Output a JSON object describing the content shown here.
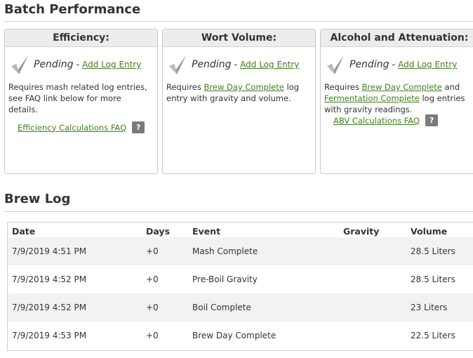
{
  "batch_performance": {
    "title": "Batch Performance",
    "cards": [
      {
        "header": "Efficiency:",
        "status": "Pending",
        "dash": "-",
        "action_label": "Add Log Entry",
        "desc_text": "Requires mash related log entries, see FAQ link below for more details.",
        "faq_label": "Efficiency Calculations FAQ",
        "help_glyph": "?"
      },
      {
        "header": "Wort Volume:",
        "status": "Pending",
        "dash": "-",
        "action_label": "Add Log Entry",
        "desc_prefix": "Requires",
        "desc_link": "Brew Day Complete",
        "desc_suffix": "log entry with gravity and volume."
      },
      {
        "header": "Alcohol and Attenuation:",
        "status": "Pending",
        "dash": "-",
        "action_label": "Add Log Entry",
        "desc_prefix": "Requires",
        "desc_link1": "Brew Day Complete",
        "desc_mid": "and",
        "desc_link2": "Fermentation Complete",
        "desc_suffix": "log entries with gravity readings.",
        "faq_label": "ABV Calculations FAQ",
        "help_glyph": "?"
      }
    ]
  },
  "brew_log": {
    "title": "Brew Log",
    "columns": {
      "date": "Date",
      "days": "Days",
      "event": "Event",
      "gravity": "Gravity",
      "volume": "Volume"
    },
    "rows": [
      {
        "date": "7/9/2019 4:51 PM",
        "days": "+0",
        "event": "Mash Complete",
        "gravity": "",
        "volume": "28.5 Liters"
      },
      {
        "date": "7/9/2019 4:52 PM",
        "days": "+0",
        "event": "Pre-Boil Gravity",
        "gravity": "",
        "volume": "28.5 Liters"
      },
      {
        "date": "7/9/2019 4:52 PM",
        "days": "+0",
        "event": "Boil Complete",
        "gravity": "",
        "volume": "23 Liters"
      },
      {
        "date": "7/9/2019 4:53 PM",
        "days": "+0",
        "event": "Brew Day Complete",
        "gravity": "",
        "volume": "22.5 Liters"
      }
    ]
  },
  "icons": {
    "status": "checkmark-icon",
    "help": "help-icon"
  },
  "colors": {
    "link": "#3f7f1e",
    "header_bg": "#ececec",
    "row_alt": "#f2f2f2",
    "help_bg": "#7a7a7a"
  }
}
